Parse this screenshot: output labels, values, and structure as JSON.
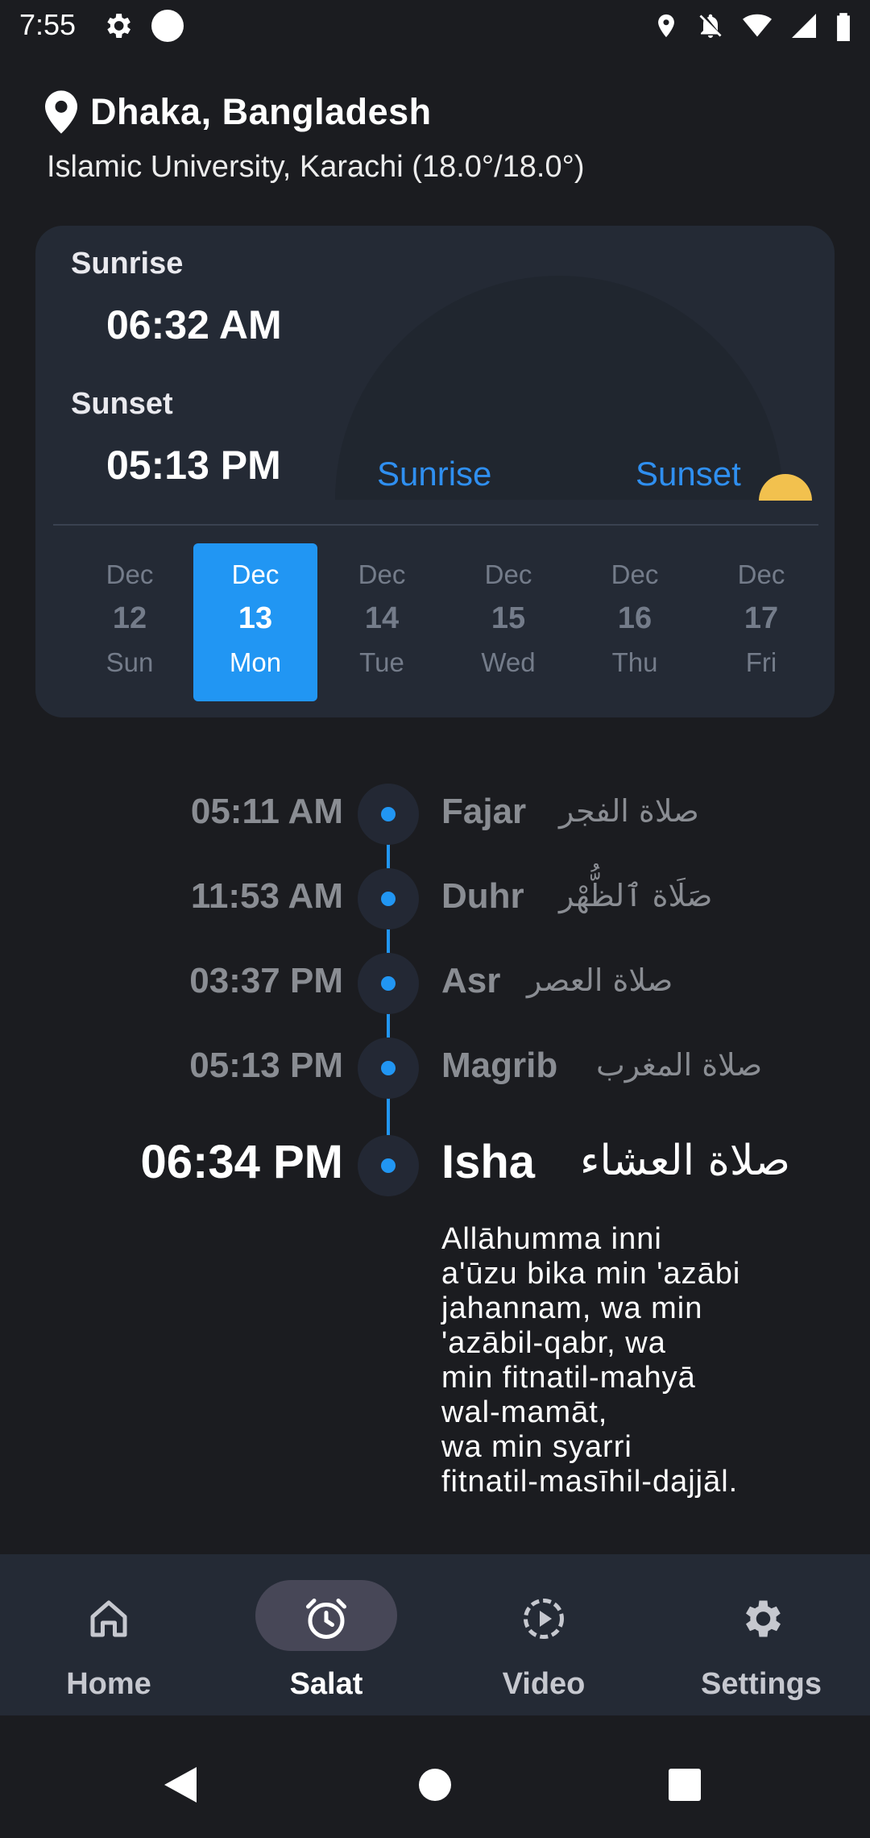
{
  "status_bar": {
    "time": "7:55",
    "icons": [
      "gear-icon",
      "circle-icon",
      "location-icon",
      "notifications-off-icon",
      "wifi-icon",
      "signal-icon",
      "battery-icon"
    ]
  },
  "location": {
    "icon": "location-pin-icon",
    "city": "Dhaka, Bangladesh",
    "method": "Islamic University, Karachi (18.0°/18.0°)"
  },
  "sun": {
    "sunrise_label": "Sunrise",
    "sunrise_time": "06:32 AM",
    "sunset_label": "Sunset",
    "sunset_time": "05:13 PM",
    "arc_sunrise_label": "Sunrise",
    "arc_sunset_label": "Sunset"
  },
  "days": [
    {
      "month": "Dec",
      "day": "12",
      "weekday": "Sun",
      "active": false
    },
    {
      "month": "Dec",
      "day": "13",
      "weekday": "Mon",
      "active": true
    },
    {
      "month": "Dec",
      "day": "14",
      "weekday": "Tue",
      "active": false
    },
    {
      "month": "Dec",
      "day": "15",
      "weekday": "Wed",
      "active": false
    },
    {
      "month": "Dec",
      "day": "16",
      "weekday": "Thu",
      "active": false
    },
    {
      "month": "Dec",
      "day": "17",
      "weekday": "Fri",
      "active": false
    }
  ],
  "prayers": [
    {
      "time": "05:11 AM",
      "name": "Fajar",
      "arabic": "صلاة الفجر",
      "current": false
    },
    {
      "time": "11:53 AM",
      "name": "Duhr",
      "arabic": "صَلَاة ٱلظُّهْر",
      "current": false
    },
    {
      "time": "03:37 PM",
      "name": "Asr",
      "arabic": "صلاة العصر",
      "current": false
    },
    {
      "time": "05:13 PM",
      "name": "Magrib",
      "arabic": "صلاة المغرب",
      "current": false
    },
    {
      "time": "06:34 PM",
      "name": "Isha",
      "arabic": "صلاة العشاء",
      "current": true
    }
  ],
  "dua": " Allāhumma inni\na'ūzu bika min 'azābi\njahannam, wa min\n'azābil-qabr, wa\nmin fitnatil-mahyā\nwal-mamāt,\nwa min syarri\nfitnatil-masīhil-dajjāl.",
  "bottom_nav": [
    {
      "label": "Home",
      "icon": "home-icon",
      "active": false
    },
    {
      "label": "Salat",
      "icon": "alarm-clock-icon",
      "active": true
    },
    {
      "label": "Video",
      "icon": "play-circle-icon",
      "active": false
    },
    {
      "label": "Settings",
      "icon": "gear-icon",
      "active": false
    }
  ],
  "colors": {
    "background": "#1b1c20",
    "card": "#242a35",
    "accent": "#2196f3",
    "sun": "#f2c14e",
    "muted_text": "#8a8d93"
  }
}
